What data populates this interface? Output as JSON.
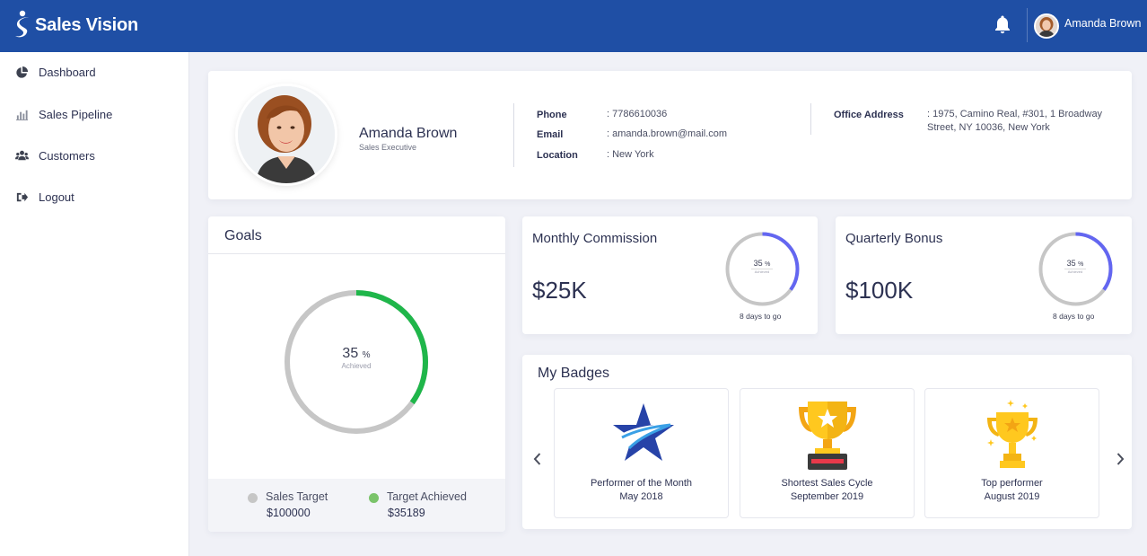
{
  "app": {
    "name": "Sales Vision",
    "user_name": "Amanda Brown"
  },
  "icons": {
    "bell": "bell-icon",
    "dashboard": "pie-chart-icon",
    "pipeline": "bar-chart-icon",
    "customers": "users-icon",
    "logout": "sign-out-icon"
  },
  "sidebar": {
    "items": [
      {
        "label": "Dashboard",
        "icon": "pie-chart-icon"
      },
      {
        "label": "Sales Pipeline",
        "icon": "bar-chart-icon"
      },
      {
        "label": "Customers",
        "icon": "users-icon"
      },
      {
        "label": "Logout",
        "icon": "sign-out-icon"
      }
    ]
  },
  "profile": {
    "name": "Amanda Brown",
    "role": "Sales Executive",
    "phone_label": "Phone",
    "phone": ": 7786610036",
    "email_label": "Email",
    "email": ": amanda.brown@mail.com",
    "location_label": "Location",
    "location": ": New York",
    "office_label": "Office Address",
    "office_line1": ": 1975, Camino Real, #301, 1 Broadway",
    "office_line2": "Street, NY 10036, New York"
  },
  "goals": {
    "title": "Goals",
    "percent": "35",
    "percent_sign": "%",
    "achieved_label": "Achieved",
    "progress_fraction": 0.35,
    "target_label": "Sales Target",
    "target_value": "$100000",
    "achieved_target_label": "Target Achieved",
    "achieved_value": "$35189"
  },
  "commission": {
    "title": "Monthly Commission",
    "amount": "$25K",
    "percent": "35",
    "percent_sign": "%",
    "achieved_label": "Achieved",
    "progress_fraction": 0.35,
    "days_left": "8 days to go"
  },
  "bonus": {
    "title": "Quarterly Bonus",
    "amount": "$100K",
    "percent": "35",
    "percent_sign": "%",
    "achieved_label": "Achieved",
    "progress_fraction": 0.35,
    "days_left": "8 days to go"
  },
  "badges": {
    "title": "My Badges",
    "items": [
      {
        "title": "Performer of the Month",
        "date": "May 2018",
        "icon": "star-icon"
      },
      {
        "title": "Shortest Sales Cycle",
        "date": "September 2019",
        "icon": "trophy-icon"
      },
      {
        "title": "Top performer",
        "date": "August 2019",
        "icon": "trophy-icon"
      }
    ]
  },
  "colors": {
    "header": "#1f4fa5",
    "goal_progress": "#1fb64a",
    "ring_track": "#c6c6c6",
    "small_ring_progress": "#6366f1",
    "legend_target": "#c6c6c6",
    "legend_achieved": "#7ac36a"
  }
}
